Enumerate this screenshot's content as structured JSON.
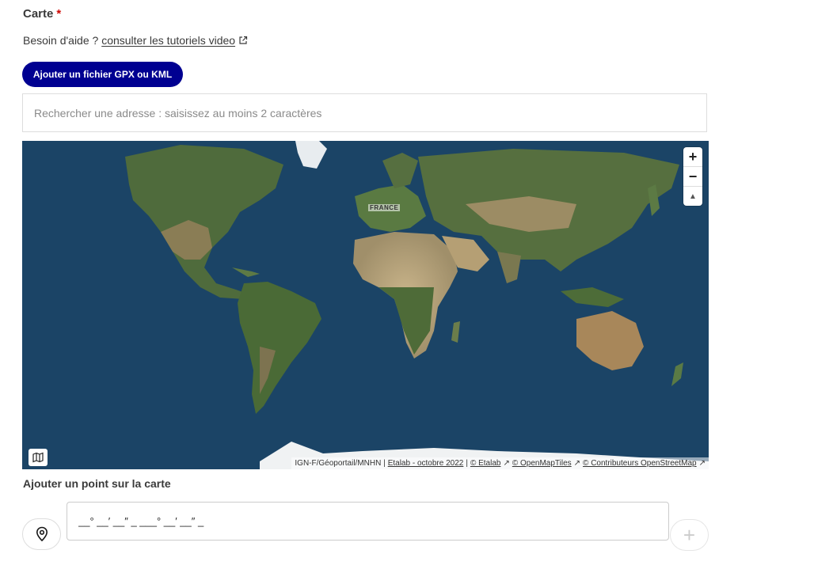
{
  "field": {
    "title": "Carte",
    "required_mark": "*",
    "help_prefix": "Besoin d'aide ?",
    "help_link": "consulter les tutoriels video"
  },
  "upload_button": {
    "label": "Ajouter un fichier GPX ou KML"
  },
  "search": {
    "placeholder": "Rechercher une adresse : saisissez au moins 2 caractères",
    "value": ""
  },
  "map": {
    "country_label": "FRANCE",
    "controls": {
      "zoom_in": "+",
      "zoom_out": "−",
      "reset_north": "▲"
    },
    "attribution": {
      "source": "IGN-F/Géoportail/MNHN |",
      "etalab_date": "Etalab - octobre 2022",
      "sep": "|",
      "etalab": "© Etalab",
      "openmaptiles": "© OpenMapTiles",
      "osm": "© Contributeurs OpenStreetMap"
    },
    "ocean_color": "#1b4466",
    "land_color": "#4d6a3a"
  },
  "point": {
    "title": "Ajouter un point sur la carte",
    "coords_value": "__° __′ __″ _ ___° __′ __″ _",
    "add_label": "+"
  },
  "colors": {
    "primary": "#000091",
    "required": "#ce0500"
  }
}
